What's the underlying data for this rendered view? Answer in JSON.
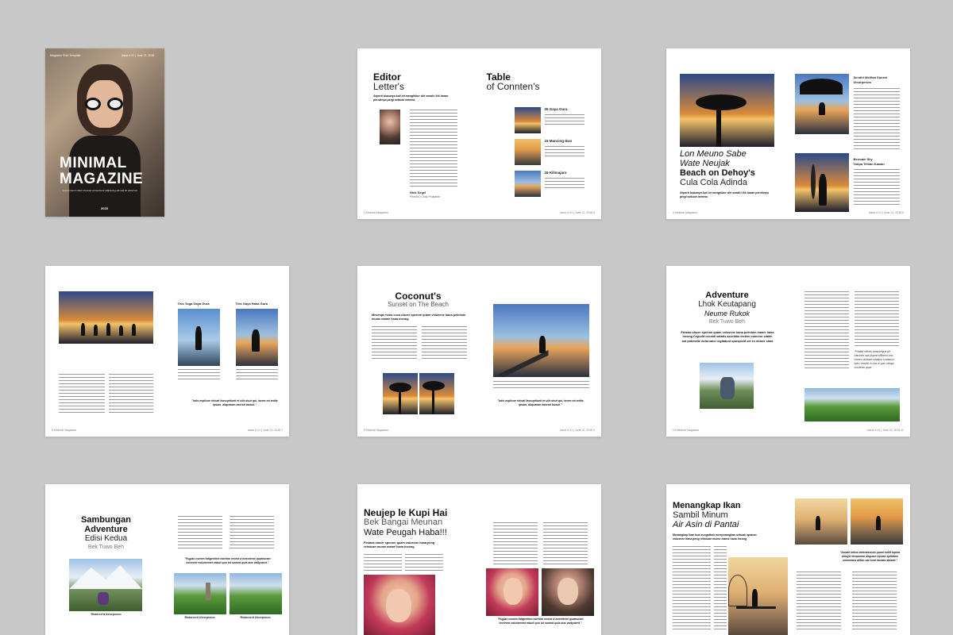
{
  "colors": {
    "background": "#c8c8c8",
    "page": "#ffffff",
    "text": "#111111"
  },
  "cover": {
    "top_line": "Magazine Print Template",
    "issue_line": "Issue # 01 | June 21, 2018",
    "title_line1": "MINIMAL",
    "title_line2": "MAGAZINE",
    "tagline": "Lorem ipsum dolor sit amet consectetur adipiscing elit sed do eiusmod",
    "bottom_mark": "2018"
  },
  "editor_spread": {
    "editor_title_bold": "Editor",
    "editor_title_light": "Letter's",
    "editor_lead": "Seperti biasanya kali ini menghibur diri sendiri ihk lawan perniknya pergi sebuah lemena",
    "editor_signature": "Nick Segel",
    "editor_role": "Penulis | Cinta Pelajaran",
    "toc_title_bold": "Table",
    "toc_title_light": "of Connten's",
    "toc_items": [
      {
        "num": "05",
        "label": "05 Gaya Gura"
      },
      {
        "num": "15",
        "label": "15 Mancing Ikan"
      },
      {
        "num": "26",
        "label": "26 Kilimajaro"
      }
    ],
    "footer_left": "2 Minimal Magazine",
    "footer_right": "Issue # 01 | June 21, 2018 3"
  },
  "beach_spread": {
    "headline_italic1": "Lon Meuno Sabe",
    "headline_italic2": "Wate Neujak",
    "headline_bold": "Beach on Dehoy's",
    "headline_light": "Cula Cola Adinda",
    "lead": "Seperti biasanya kali ini menghibur diri sendiri ihk lawan perniknya pergi sebuah lemena",
    "side_title1a": "Sendiri Melihat Sunset",
    "side_title1b": "Ulcorperum",
    "side_title2a": "Bermain Sky",
    "side_title2b": "Tanpa Teman Kawan",
    "footer_left": "4 Minimal Magazine",
    "footer_right": "Issue # 01 | June 21, 2018 5"
  },
  "yoga_spread": {
    "caption1": "This Yoga Gaya Gura",
    "caption2": "This Gaya Hana Gura",
    "quote": "\"Iutis explicae rhicati faccuptiunti et ulla dout qui, lorem ed enitis ipsam, aliquatam aserati bunuli.\"",
    "footer_left": "6 Minimal Magazine",
    "footer_right": "Issue # 01 | June 21, 2018 7"
  },
  "coconut_spread": {
    "title_bold": "Coconut's",
    "title_light": "Sunset on The Beach",
    "lead": "Mesenpe hona cuca ulacer sperum quam volusene hana pelmium mume mame hana lneong",
    "quote": "\"Iutis explicae rhicati faccuptiunti et ulla dout qui, lorem ed enitis ipsam, aliquatam aserati bunuli.\"",
    "footer_left": "8 Minimal Magazine",
    "footer_right": "Issue # 01 | June 21, 2018 9"
  },
  "adventure_spread": {
    "title_bold": "Adventure",
    "title_light": "Lhok Keutapang",
    "title_italic": "Neume Rukok",
    "title_sub": "Bek Tuwo Beh",
    "lead": "Firtana ulacer sperum quam volusene hana pelmium mame hana lneong Cepudit exceati satatis asselidia tectem estector sitaim aut potimelle dolorumor cigitatunt quuspicid set ex dolore sima",
    "quote": "\"Pelitati officiis pristumque pit haruntio opti jisped officient into fractus duisiae vindipin cusamus epro venditi, to bia ni que mingui cuisieum quat.\"",
    "footer_left": "10 Minimal Magazine",
    "footer_right": "Issue # 01 | June 21, 2018 11"
  },
  "sambungan_spread": {
    "title_bold1": "Sambungan",
    "title_bold2": "Adventure",
    "title_light": "Edisi Kedua",
    "title_sub": "Bek Tuwo Beh",
    "caption1": "Ristorcerit Ulcorperum",
    "quote": "\"Fugias conem fatigeritem estrhim recest d enectemo quateuram moreent volutemnet rebuit quo ist sumed quia dus valiquient.\"",
    "caption2": "Ristorcerit Ulcorperum",
    "caption3": "Ristorcerit Ulcorperum"
  },
  "kupi_spread": {
    "title_bold": "Neujep le Kupi Hai",
    "title_light": "Bek Bangai Meunan",
    "title_mixed": "Wate Peugah Haba!!!",
    "lead": "Fintana ulacer sperum quam volusene hana peng relmiuan mume mame hana lneong",
    "quote": "\"Fugias conem fatigeritem estrhim recest d enectemo quateuram moreent volutemnet rebuit quo ist sumed quia dus valiquient.\""
  },
  "ikan_spread": {
    "title_bold": "Menangkap Ikan",
    "title_light": "Sambil Minum",
    "title_italic": "Air Asin di Pantai",
    "lead": "Menangkap ikan bua sungaikah menyenangkan sebuah spaium volusene hana peng relmiuan mume mame hana lneong",
    "quote": "\"Aunde intius delenescium quam sollit luptas delujet temporem aliquam equiae aptiatios samnimus dillan nat bunt ibulata abiaeit.\""
  }
}
